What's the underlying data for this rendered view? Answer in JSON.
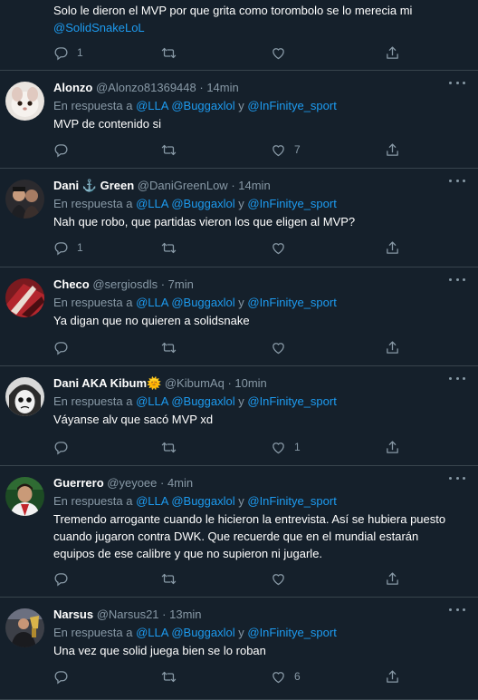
{
  "tweets": [
    {
      "text_line1": "Solo le dieron el MVP por que grita como torombolo se lo merecia mi",
      "mention": "@SolidSnakeLoL",
      "replies": "1",
      "retweets": "",
      "likes": ""
    },
    {
      "name": "Alonzo",
      "handle": "@Alonzo81369448",
      "time": "· 14min",
      "reply_prefix": "En respuesta a",
      "reply_to_1": "@LLA",
      "reply_to_2": "@Buggaxlol",
      "reply_and": "y",
      "reply_to_3": "@InFinitye_sport",
      "text": "MVP de contenido si",
      "replies": "",
      "retweets": "",
      "likes": "7"
    },
    {
      "name": "Dani ⚓ Green",
      "handle": "@DaniGreenLow",
      "time": "· 14min",
      "reply_prefix": "En respuesta a",
      "reply_to_1": "@LLA",
      "reply_to_2": "@Buggaxlol",
      "reply_and": "y",
      "reply_to_3": "@InFinitye_sport",
      "text": "Nah que robo, que partidas vieron los que eligen al MVP?",
      "replies": "1",
      "retweets": "",
      "likes": ""
    },
    {
      "name": "Checo",
      "handle": "@sergiosdls",
      "time": "· 7min",
      "reply_prefix": "En respuesta a",
      "reply_to_1": "@LLA",
      "reply_to_2": "@Buggaxlol",
      "reply_and": "y",
      "reply_to_3": "@InFinitye_sport",
      "text": "Ya digan que no quieren a solidsnake",
      "replies": "",
      "retweets": "",
      "likes": ""
    },
    {
      "name": "Dani AKA Kibum🌞",
      "handle": "@KibumAq",
      "time": "· 10min",
      "reply_prefix": "En respuesta a",
      "reply_to_1": "@LLA",
      "reply_to_2": "@Buggaxlol",
      "reply_and": "y",
      "reply_to_3": "@InFinitye_sport",
      "text": "Váyanse alv que sacó MVP xd",
      "replies": "",
      "retweets": "",
      "likes": "1"
    },
    {
      "name": "Guerrero",
      "handle": "@yeyoee",
      "time": "· 4min",
      "reply_prefix": "En respuesta a",
      "reply_to_1": "@LLA",
      "reply_to_2": "@Buggaxlol",
      "reply_and": "y",
      "reply_to_3": "@InFinitye_sport",
      "text_lines": [
        "Tremendo arrogante cuando le hicieron la entrevista. Así se hubiera puesto",
        "cuando jugaron contra DWK. Que recuerde que en el mundial estarán",
        "equipos de ese calibre y que no supieron ni jugarle."
      ],
      "replies": "",
      "retweets": "",
      "likes": ""
    },
    {
      "name": "Narsus",
      "handle": "@Narsus21",
      "time": "· 13min",
      "reply_prefix": "En respuesta a",
      "reply_to_1": "@LLA",
      "reply_to_2": "@Buggaxlol",
      "reply_and": "y",
      "reply_to_3": "@InFinitye_sport",
      "text": "Una vez que solid juega bien se lo roban",
      "replies": "",
      "retweets": "",
      "likes": "6"
    }
  ],
  "icons": {
    "reply": "reply-icon",
    "retweet": "retweet-icon",
    "like": "heart-icon",
    "share": "share-icon",
    "more": "more-icon"
  },
  "colors": {
    "background": "#15202b",
    "divider": "#38444d",
    "secondary_text": "#8899a6",
    "link": "#1d9bf0"
  }
}
